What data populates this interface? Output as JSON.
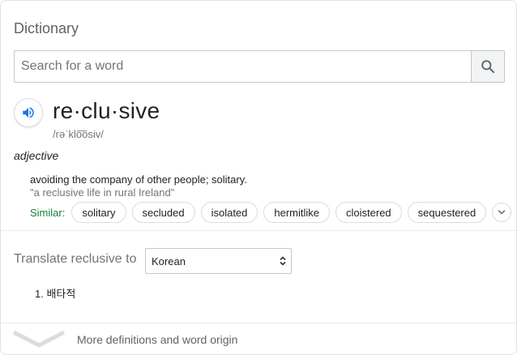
{
  "panel": {
    "title": "Dictionary"
  },
  "search": {
    "placeholder": "Search for a word",
    "value": ""
  },
  "entry": {
    "word": "re·clu·sive",
    "pronunciation": "/rəˈklo͞osiv/",
    "part_of_speech": "adjective",
    "definition": "avoiding the company of other people; solitary.",
    "example": "\"a reclusive life in rural Ireland\"",
    "similar_label": "Similar:",
    "similar": [
      "solitary",
      "secluded",
      "isolated",
      "hermitlike",
      "cloistered",
      "sequestered"
    ]
  },
  "translate": {
    "label": "Translate reclusive to",
    "selected_language": "Korean",
    "results": [
      "1.  배타적"
    ]
  },
  "footer": {
    "more_label": "More definitions and word origin"
  },
  "colors": {
    "accent_blue": "#1a73e8",
    "similar_green": "#188038",
    "muted": "#70757a"
  }
}
